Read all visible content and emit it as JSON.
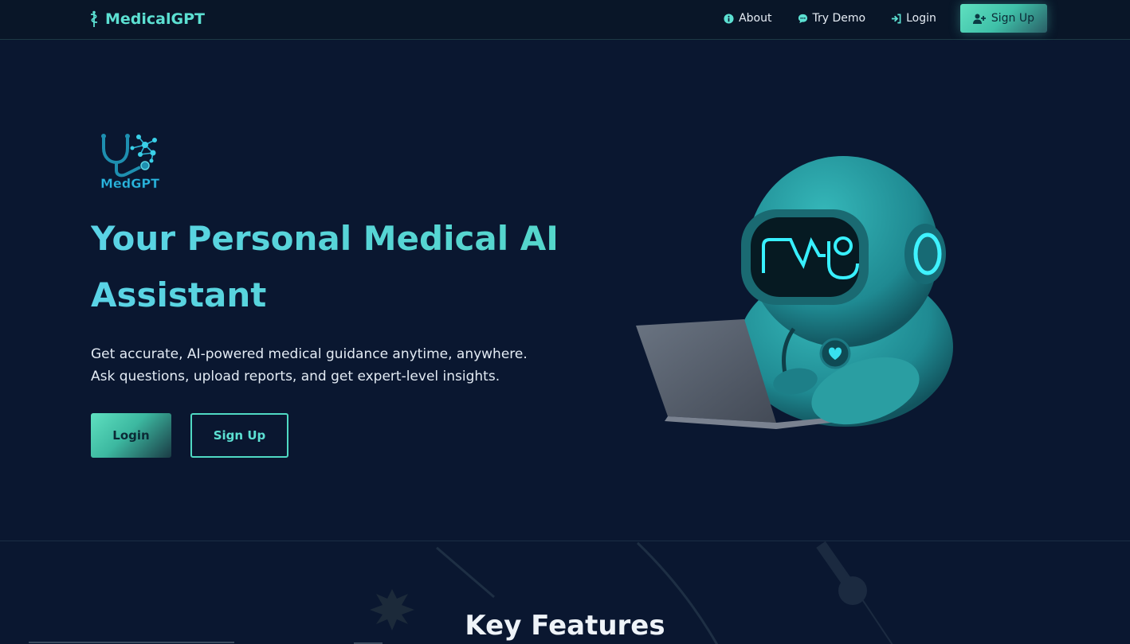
{
  "brand": {
    "name": "MedicalGPT",
    "icon": "caduceus-icon"
  },
  "nav": {
    "about": "About",
    "try_demo": "Try Demo",
    "login": "Login",
    "signup": "Sign Up"
  },
  "hero": {
    "logo_text": "MedGPT",
    "title": "Your Personal Medical AI Assistant",
    "subtitle_line1": "Get accurate, AI-powered medical guidance anytime, anywhere.",
    "subtitle_line2": "Ask questions, upload reports, and get expert-level insights.",
    "login_button": "Login",
    "signup_button": "Sign Up"
  },
  "features": {
    "title": "Key Features"
  },
  "colors": {
    "background": "#0a1730",
    "accent": "#5ce0d2",
    "accent_gradient_start": "#5fe0c0",
    "text": "#e6edf5"
  }
}
